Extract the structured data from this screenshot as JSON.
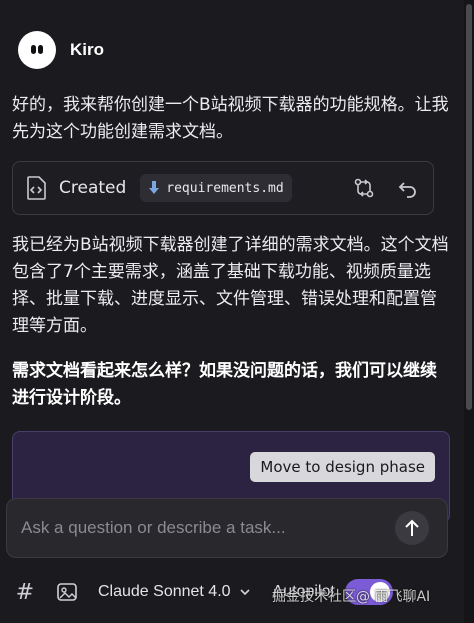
{
  "header": {
    "assistant_name": "Kiro"
  },
  "messages": {
    "intro": "好的，我来帮你创建一个B站视频下载器的功能规格。让我先为这个功能创建需求文档。",
    "summary": "我已经为B站视频下载器创建了详细的需求文档。这个文档包含了7个主要需求，涵盖了基础下载功能、视频质量选择、批量下载、进度显示、文件管理、错误处理和配置管理等方面。",
    "question": "需求文档看起来怎么样？如果没问题的话，我们可以继续进行设计阶段。"
  },
  "created_card": {
    "label": "Created",
    "file_name": "requirements.md",
    "icons": [
      "file-code-icon",
      "download-arrow-icon",
      "compare-icon",
      "undo-icon"
    ]
  },
  "phase": {
    "button_label": "Move to design phase"
  },
  "composer": {
    "placeholder": "Ask a question or describe a task..."
  },
  "toolbar": {
    "model": "Claude Sonnet 4.0",
    "mode": "Autopilot",
    "autopilot_enabled": true
  },
  "watermark": {
    "text": "掘金技术社区@ 雨飞聊AI"
  },
  "colors": {
    "background": "#1b1b1f",
    "accent": "#7c5cd6",
    "panel": "#2c2342"
  }
}
